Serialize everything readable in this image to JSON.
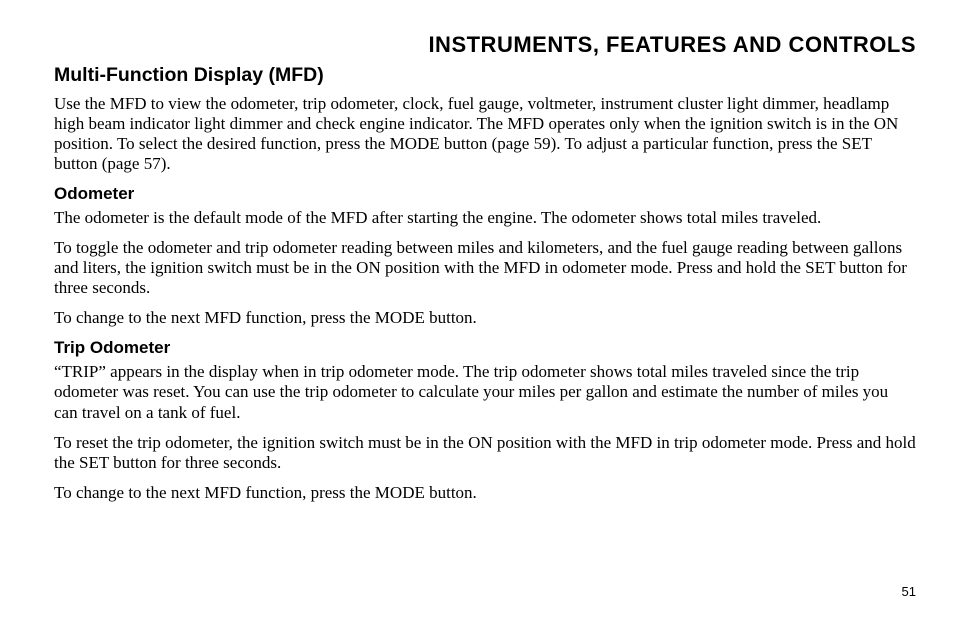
{
  "header": "INSTRUMENTS, FEATURES AND CONTROLS",
  "section_title": "Multi-Function Display (MFD)",
  "intro_paragraph": "Use the MFD to view the odometer, trip odometer, clock, fuel gauge, voltmeter, instrument cluster light dimmer, headlamp high beam indicator light dimmer and check engine indicator. The MFD operates only when the ignition switch is in the ON position. To select the desired function, press the MODE button (page 59). To adjust a particular function, press the SET button (page 57).",
  "subsections": [
    {
      "title": "Odometer",
      "paragraphs": [
        "The odometer is the default mode of the MFD after starting the engine. The odometer shows total miles traveled.",
        "To toggle the odometer and trip odometer reading between miles and kilometers, and the fuel gauge reading between gallons and liters, the ignition switch must be in the ON position with the MFD in odometer mode. Press and hold the SET button for three seconds.",
        "To change to the next MFD function, press the MODE button."
      ]
    },
    {
      "title": "Trip Odometer",
      "paragraphs": [
        "“TRIP” appears in the display when in trip odometer mode. The trip odometer shows total miles traveled since the trip odometer was reset. You can use the trip odometer to calculate your miles per gallon and estimate the number of miles you can travel on a tank of fuel.",
        "To reset the trip odometer, the ignition switch must be in the ON position with the MFD in trip odometer mode. Press and hold the SET button for three seconds.",
        "To change to the next MFD function, press the MODE button."
      ]
    }
  ],
  "page_number": "51"
}
